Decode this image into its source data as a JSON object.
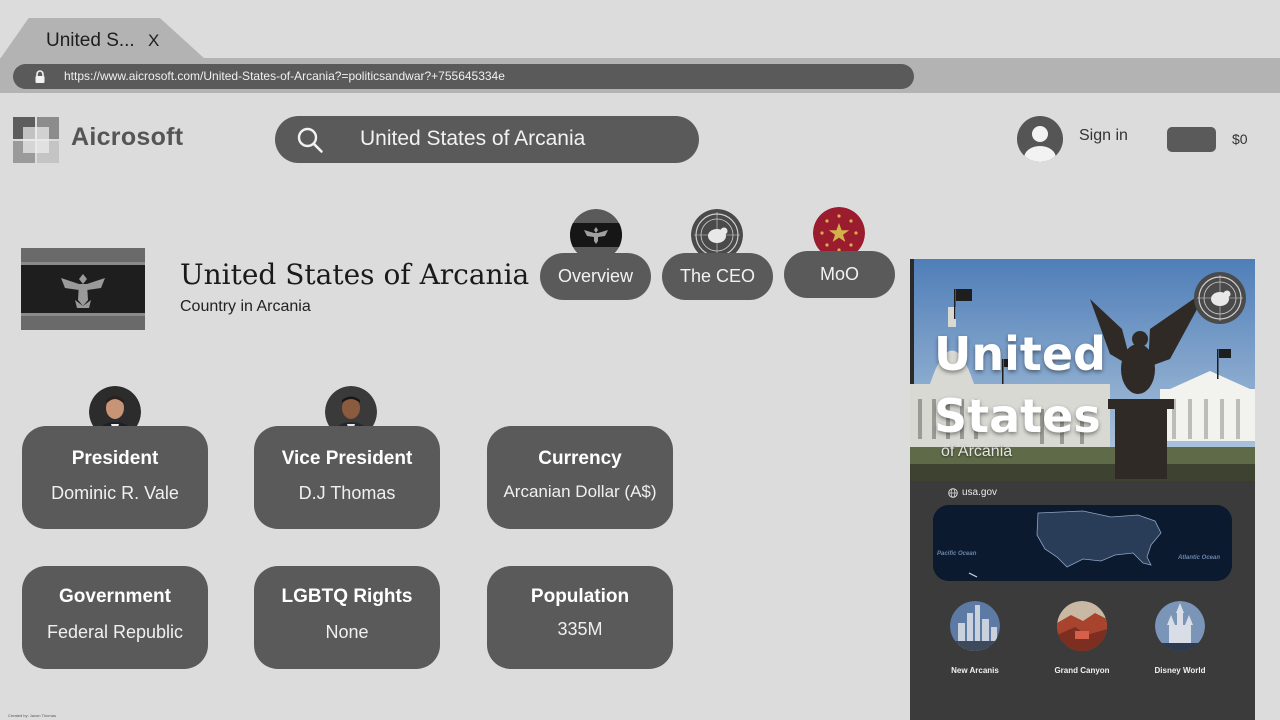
{
  "browser": {
    "tab_title": "United S...",
    "tab_close": "X",
    "url": "https://www.aicrosoft.com/United-States-of-Arcania?=politicsandwar?+755645334e"
  },
  "header": {
    "logo_text": "Aicrosoft",
    "search_text": "United States of Arcania",
    "sign_in": "Sign in",
    "balance": "$0"
  },
  "country": {
    "title": "United States of Arcania",
    "subtitle": "Country in Arcania"
  },
  "nav": [
    {
      "label": "Overview",
      "icon": "eagle-emblem-icon"
    },
    {
      "label": "The CEO",
      "icon": "seal-icon"
    },
    {
      "label": "MoO",
      "icon": "star-emblem-icon"
    }
  ],
  "cards": [
    {
      "label": "President",
      "value": "Dominic R. Vale"
    },
    {
      "label": "Vice President",
      "value": "D.J Thomas"
    },
    {
      "label": "Currency",
      "value": "Arcanian Dollar (A$)"
    },
    {
      "label": "Government",
      "value": "Federal Republic"
    },
    {
      "label": "LGBTQ Rights",
      "value": "None"
    },
    {
      "label": "Population",
      "value": "335M"
    }
  ],
  "panel": {
    "hero_title": "United States",
    "hero_sub": "of Arcania",
    "site": "usa.gov",
    "map_labels": {
      "west": "Pacific Ocean",
      "east": "Atlantic Ocean"
    },
    "places": [
      {
        "name": "New Arcanis"
      },
      {
        "name": "Grand Canyon"
      },
      {
        "name": "Disney World"
      }
    ]
  },
  "credit": "Created by: Jaxon Thomas",
  "colors": {
    "page_bg": "#dcdcdc",
    "chrome": "#b3b3b3",
    "pill": "#5a5a5a",
    "panel": "#3b3b3b",
    "moo_badge": "#9b1c2e"
  }
}
